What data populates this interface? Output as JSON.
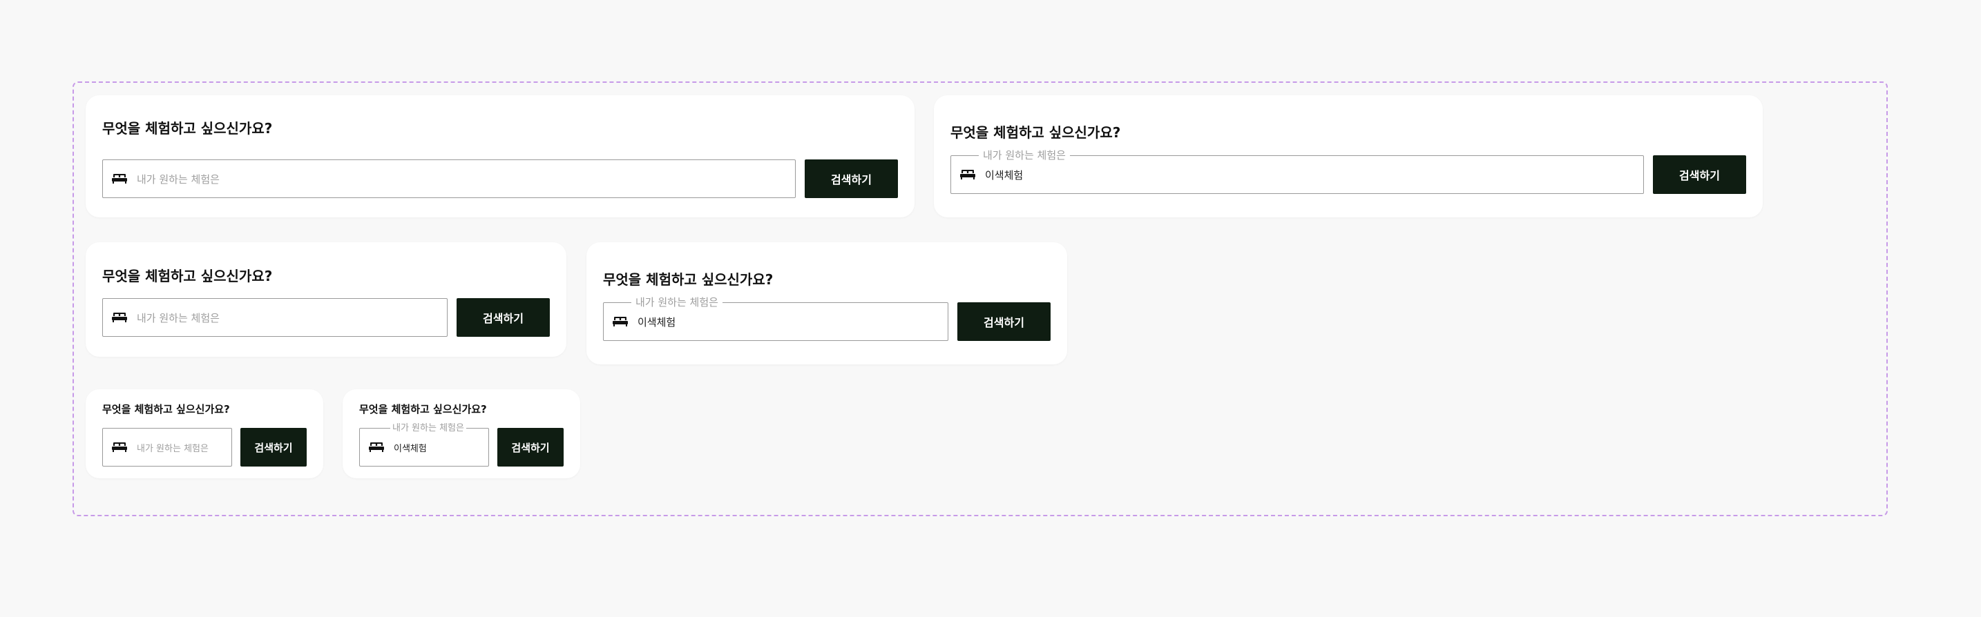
{
  "title": "무엇을 체험하고 싶으신가요?",
  "placeholder": "내가 원하는 체험은",
  "field_label": "내가 원하는 체험은",
  "filled_value": "이색체험",
  "button_label": "검색하기",
  "icon": "bed-icon",
  "colors": {
    "page_background": "#f8f8f8",
    "card_background": "#ffffff",
    "button_background": "#0f1d12",
    "button_text": "#ffffff",
    "frame_border": "#c79ae8",
    "field_border": "#9a9a9a",
    "placeholder_text": "#9e9e9e"
  }
}
